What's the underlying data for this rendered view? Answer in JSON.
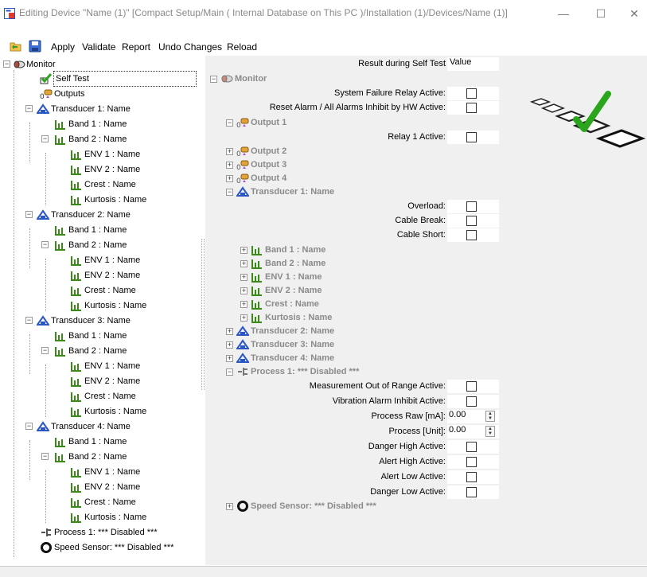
{
  "window": {
    "title": "Editing Device \"Name (1)\" [Compact Setup/Main ( Internal Database on This PC )/Installation (1)/Devices/Name (1)]",
    "minimize": "—",
    "maximize": "☐",
    "close": "✕"
  },
  "toolbar": {
    "apply": "Apply",
    "validate": "Validate",
    "report": "Report",
    "undo": "Undo Changes",
    "reload": "Reload"
  },
  "tree": {
    "monitor": "Monitor",
    "self_test": "Self Test",
    "outputs": "Outputs",
    "transducer1": "Transducer 1: Name",
    "transducer2": "Transducer 2: Name",
    "transducer3": "Transducer 3: Name",
    "transducer4": "Transducer 4: Name",
    "band1": "Band 1 : Name",
    "band2": "Band 2 : Name",
    "env1": "ENV 1 : Name",
    "env2": "ENV 2 : Name",
    "crest": "Crest : Name",
    "kurtosis": "Kurtosis : Name",
    "process1": "Process 1:  *** Disabled ***",
    "speed": "Speed Sensor:  *** Disabled ***"
  },
  "panel": {
    "header_result": "Result during Self Test",
    "header_value": "Value",
    "monitor": "Monitor",
    "system_failure": "System Failure Relay Active:",
    "reset_alarm": "Reset Alarm / All Alarms Inhibit by HW Active:",
    "output1": "Output 1",
    "relay1": "Relay 1 Active:",
    "output2": "Output 2",
    "output3": "Output 3",
    "output4": "Output 4",
    "transducer1": "Transducer 1: Name",
    "overload": "Overload:",
    "cable_break": "Cable Break:",
    "cable_short": "Cable Short:",
    "band1": "Band 1 : Name",
    "band2": "Band 2 : Name",
    "env1": "ENV 1 : Name",
    "env2": "ENV 2 : Name",
    "crest": "Crest : Name",
    "kurtosis": "Kurtosis : Name",
    "transducer2": "Transducer 2: Name",
    "transducer3": "Transducer 3: Name",
    "transducer4": "Transducer 4: Name",
    "process1": "Process 1:  *** Disabled ***",
    "meas_out_of_range": "Measurement Out of Range Active:",
    "vib_alarm_inhibit": "Vibration Alarm Inhibit Active:",
    "process_raw": "Process Raw [mA]:",
    "process_raw_val": "0.00",
    "process_unit": "Process [Unit]:",
    "process_unit_val": "0.00",
    "danger_high": "Danger High Active:",
    "alert_high": "Alert High Active:",
    "alert_low": "Alert Low Active:",
    "danger_low": "Danger Low Active:",
    "speed": "Speed Sensor:  *** Disabled ***"
  },
  "colors": {
    "group_text": "#8a8a8a",
    "transducer_icon": "#2a56c6",
    "band_icon": "#3a8a1a",
    "check_green": "#2aa51c",
    "panel_bg": "#f0f0f0"
  }
}
